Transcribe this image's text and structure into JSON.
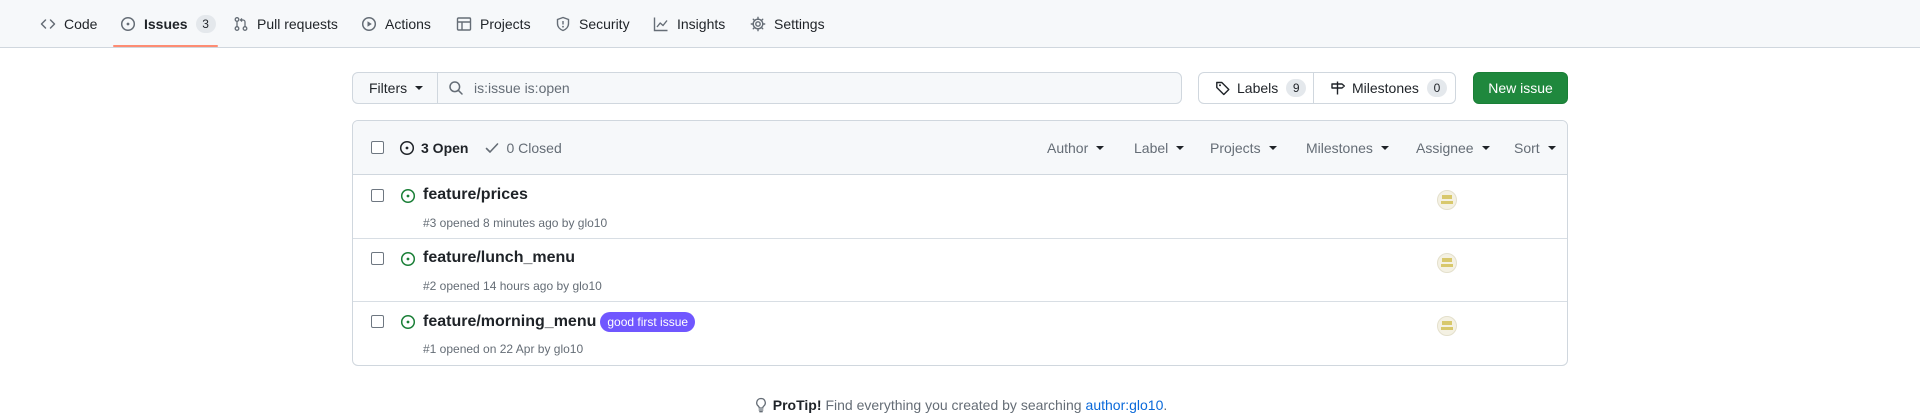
{
  "nav": {
    "code": "Code",
    "issues": "Issues",
    "issues_count": "3",
    "pull_requests": "Pull requests",
    "actions": "Actions",
    "projects": "Projects",
    "security": "Security",
    "insights": "Insights",
    "settings": "Settings"
  },
  "subnav": {
    "filters_label": "Filters",
    "search_value": "is:issue is:open",
    "labels_label": "Labels",
    "labels_count": "9",
    "milestones_label": "Milestones",
    "milestones_count": "0",
    "new_issue_label": "New issue"
  },
  "header": {
    "open_label": "3 Open",
    "closed_label": "0 Closed",
    "filters": [
      "Author",
      "Label",
      "Projects",
      "Milestones",
      "Assignee",
      "Sort"
    ]
  },
  "issues": [
    {
      "title": "feature/prices",
      "meta": "#3 opened 8 minutes ago by glo10",
      "label": ""
    },
    {
      "title": "feature/lunch_menu",
      "meta": "#2 opened 14 hours ago by glo10",
      "label": ""
    },
    {
      "title": "feature/morning_menu",
      "meta": "#1 opened on 22 Apr by glo10",
      "label": "good first issue"
    }
  ],
  "protip": {
    "lead": "ProTip!",
    "text": "Find everything you created by searching",
    "link": "author:glo10",
    "tail": "."
  },
  "colors": {
    "accent_green": "#1f883d",
    "open_icon": "#1a7f37",
    "label_purple": "#7057ff",
    "link_blue": "#0969da",
    "underline": "#fd8c73"
  }
}
